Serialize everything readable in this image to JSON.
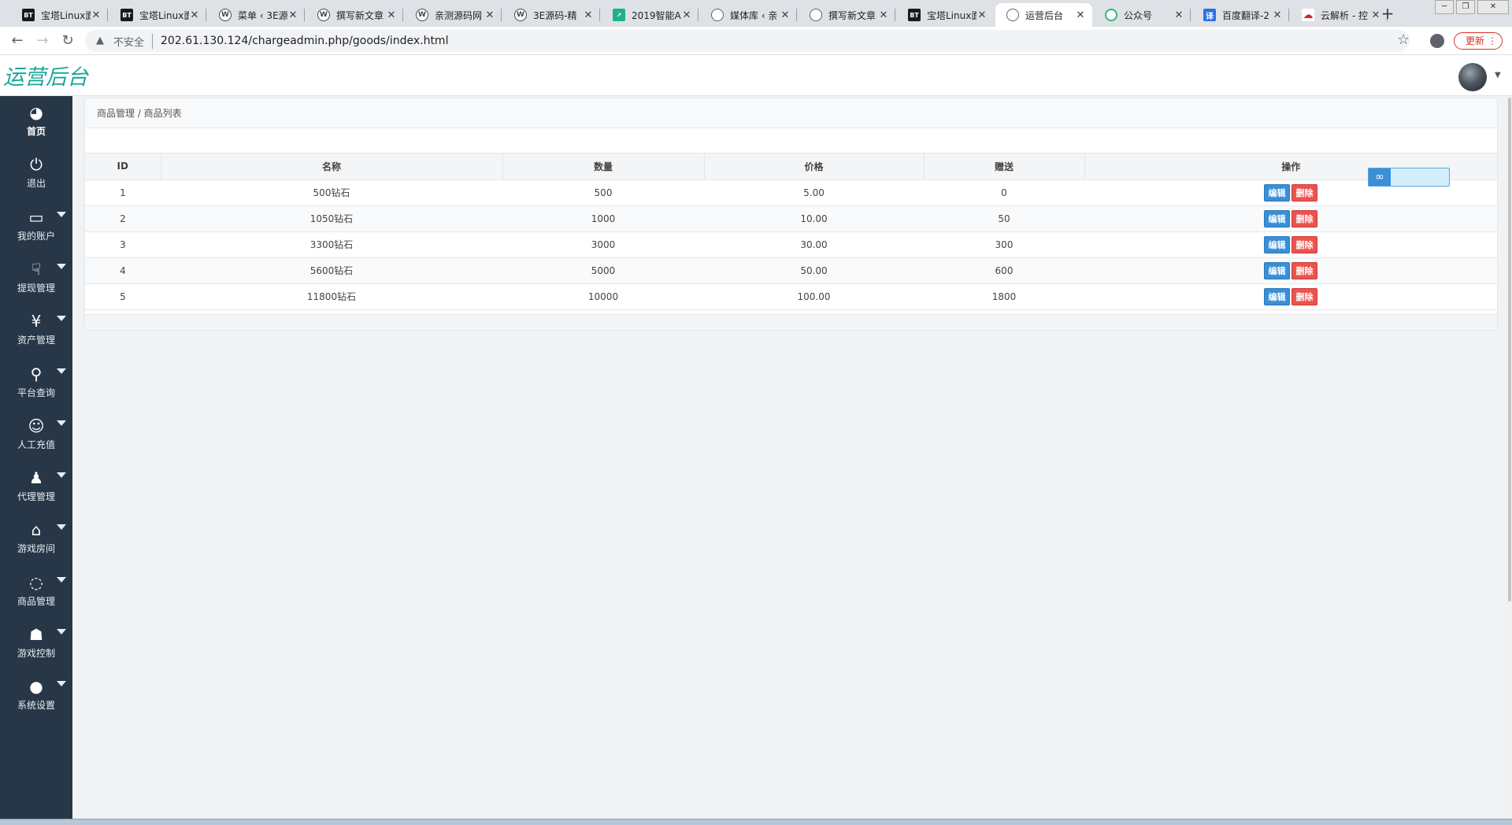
{
  "browser": {
    "tabs": [
      {
        "title": "宝塔Linux面",
        "icon": "bt"
      },
      {
        "title": "宝塔Linux面",
        "icon": "bt"
      },
      {
        "title": "菜单 ‹ 3E源",
        "icon": "wp"
      },
      {
        "title": "撰写新文章",
        "icon": "wp"
      },
      {
        "title": "亲测源码网",
        "icon": "wp"
      },
      {
        "title": "3E源码-精",
        "icon": "wp"
      },
      {
        "title": "2019智能A",
        "icon": "chart"
      },
      {
        "title": "媒体库 ‹ 亲",
        "icon": "globe"
      },
      {
        "title": "撰写新文章",
        "icon": "globe"
      },
      {
        "title": "宝塔Linux面",
        "icon": "bt"
      },
      {
        "title": "运营后台",
        "icon": "globe"
      },
      {
        "title": "公众号",
        "icon": "green"
      },
      {
        "title": "百度翻译-2",
        "icon": "fanyi"
      },
      {
        "title": "云解析 - 控",
        "icon": "cloud"
      }
    ],
    "active_tab_index": 10,
    "security_label": "不安全",
    "url": "202.61.130.124/chargeadmin.php/goods/index.html",
    "update_label": "更新"
  },
  "app": {
    "logo": "运营后台",
    "sidebar": [
      {
        "label": "首页",
        "icon": "dashboard-icon",
        "has_caret": false,
        "active": true
      },
      {
        "label": "退出",
        "icon": "power-icon",
        "has_caret": false
      },
      {
        "label": "我的账户",
        "icon": "monitor-icon",
        "has_caret": true
      },
      {
        "label": "提现管理",
        "icon": "thumbs-down-icon",
        "has_caret": true
      },
      {
        "label": "资产管理",
        "icon": "yen-icon",
        "has_caret": true
      },
      {
        "label": "平台查询",
        "icon": "search-icon",
        "has_caret": true
      },
      {
        "label": "人工充值",
        "icon": "smile-icon",
        "has_caret": true
      },
      {
        "label": "代理管理",
        "icon": "person-icon",
        "has_caret": true
      },
      {
        "label": "游戏房间",
        "icon": "home-icon",
        "has_caret": true
      },
      {
        "label": "商品管理",
        "icon": "leaf-icon",
        "has_caret": true
      },
      {
        "label": "游戏控制",
        "icon": "users-icon",
        "has_caret": true
      },
      {
        "label": "系统设置",
        "icon": "comment-icon",
        "has_caret": true
      }
    ],
    "breadcrumb": "商品管理 / 商品列表",
    "table": {
      "headers": [
        "ID",
        "名称",
        "数量",
        "价格",
        "赠送",
        "操作"
      ],
      "rows": [
        [
          "1",
          "500钻石",
          "500",
          "5.00",
          "0"
        ],
        [
          "2",
          "1050钻石",
          "1000",
          "10.00",
          "50"
        ],
        [
          "3",
          "3300钻石",
          "3000",
          "30.00",
          "300"
        ],
        [
          "4",
          "5600钻石",
          "5000",
          "50.00",
          "600"
        ],
        [
          "5",
          "11800钻石",
          "10000",
          "100.00",
          "1800"
        ]
      ],
      "edit_label": "编辑",
      "delete_label": "删除"
    }
  },
  "colors": {
    "sidebar_bg": "#283747",
    "logo": "#1aa79a",
    "edit_button": "#3a8fd6",
    "delete_button": "#e9544f"
  }
}
